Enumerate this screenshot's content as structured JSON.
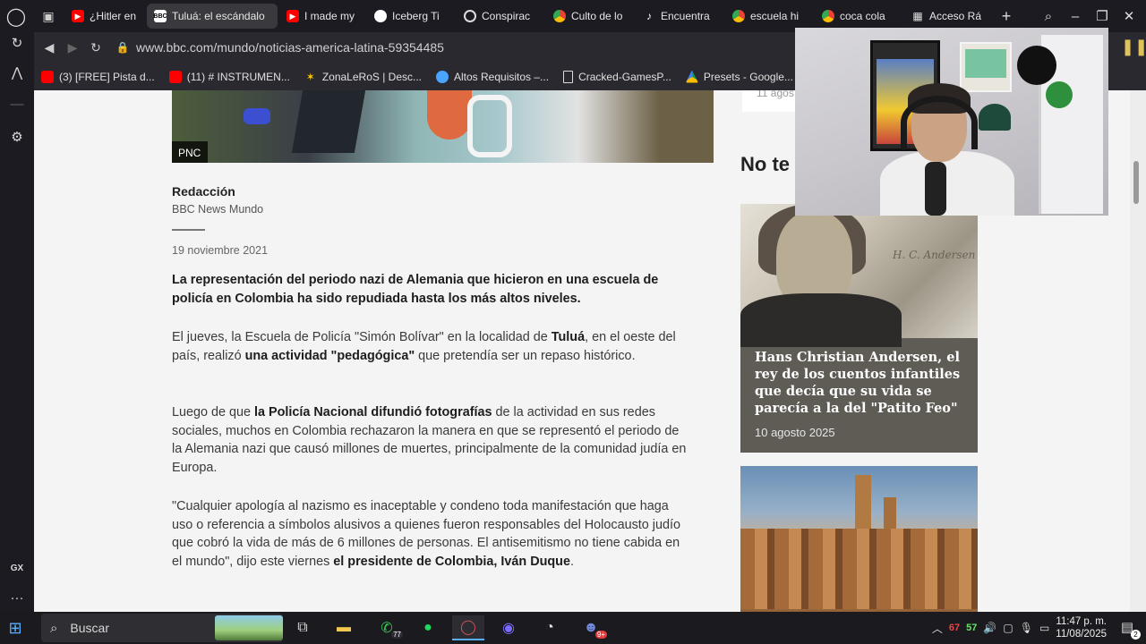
{
  "tabs": [
    {
      "title": "¿Hitler en Colombia?",
      "icon": "youtube-icon"
    },
    {
      "title": "Tuluá: el escándalo",
      "icon": "bbc-icon",
      "active": true
    },
    {
      "title": "I made my",
      "icon": "youtube-icon"
    },
    {
      "title": "Iceberg Ti",
      "icon": "globe-icon"
    },
    {
      "title": "Conspirac",
      "icon": "openai-icon"
    },
    {
      "title": "Culto de lo",
      "icon": "chrome-icon"
    },
    {
      "title": "Encuentra",
      "icon": "tiktok-icon"
    },
    {
      "title": "escuela hi",
      "icon": "chrome-icon"
    },
    {
      "title": "coca cola",
      "icon": "chrome-icon"
    },
    {
      "title": "Acceso Rá",
      "icon": "grid-icon"
    }
  ],
  "address_bar": {
    "url": "www.bbc.com/mundo/noticias-america-latina-59354485"
  },
  "bookmarks": [
    {
      "label": "(3) [FREE] Pista d...",
      "icon": "youtube-icon"
    },
    {
      "label": "(11) # INSTRUMEN...",
      "icon": "youtube-icon"
    },
    {
      "label": "ZonaLeRoS | Desc...",
      "icon": "zonaleros-icon"
    },
    {
      "label": "Altos Requisitos –...",
      "icon": "steam-icon"
    },
    {
      "label": "Cracked-GamesP...",
      "icon": "page-icon"
    },
    {
      "label": "Presets - Google...",
      "icon": "drive-icon"
    }
  ],
  "article": {
    "image_credit": "PNC",
    "author": "Redacción",
    "organization": "BBC News Mundo",
    "date": "19 noviembre 2021",
    "lead": "La representación del periodo nazi de Alemania que hicieron en una escuela de policía en Colombia ha sido repudiada hasta los más altos niveles.",
    "p1": {
      "a": "El jueves, la Escuela de Policía \"Simón Bolívar\" en la localidad de ",
      "b": "Tuluá",
      "c": ", en el oeste del país, realizó ",
      "d": "una actividad \"pedagógica\"",
      "e": " que pretendía ser un repaso histórico."
    },
    "p2": {
      "a": "Luego de que ",
      "b": "la Policía Nacional difundió fotografías",
      "c": " de la actividad en sus redes sociales, muchos en Colombia rechazaron la manera en que se representó el periodo de la Alemania nazi que causó millones de muertes, principalmente de la comunidad judía en Europa."
    },
    "p3": {
      "a": "\"Cualquier apología al nazismo es inaceptable y condeno toda manifestación que haga uso o referencia a símbolos alusivos a quienes fueron responsables del Holocausto judío que cobró la vida de más de 6 millones de personas. El antisemitismo no tiene cabida en el mundo\", dijo este viernes ",
      "b": "el presidente de Colombia, Iván Duque",
      "c": "."
    }
  },
  "sidebar_right": {
    "top_card_text": "11 agos",
    "section_title": "No te",
    "cards": [
      {
        "title": "Hans Christian Andersen, el rey de los cuentos infantiles que decía que su vida se parecía a la del \"Patito Feo\"",
        "date": "10 agosto 2025"
      }
    ]
  },
  "taskbar": {
    "search_placeholder": "Buscar",
    "whatsapp_badge": "77",
    "discord_badge": "9+",
    "tray_red": "67",
    "tray_green": "57",
    "time": "11:47 p. m.",
    "date": "11/08/2025",
    "notification_count": "2"
  },
  "colors": {
    "accent": "#5aaeff",
    "tab_active": "#3a3a3e"
  }
}
